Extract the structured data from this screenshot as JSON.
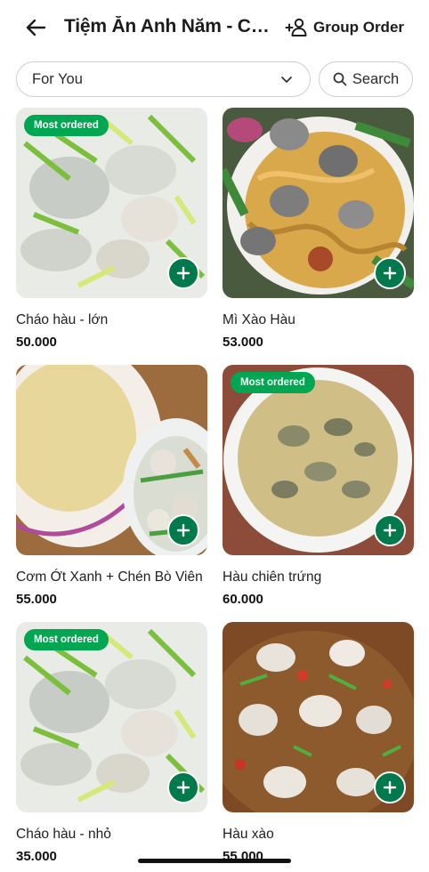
{
  "header": {
    "title": "Tiệm Ăn Anh Năm - Chợ Lớn",
    "group_order_label": "Group Order"
  },
  "filter": {
    "category_value": "For You",
    "search_label": "Search"
  },
  "badges": {
    "most_ordered": "Most ordered"
  },
  "colors": {
    "accent": "#00a651",
    "add_button": "#00794c"
  },
  "icons": {
    "back": "arrow-left-icon",
    "group": "group-add-icon",
    "chevron": "chevron-down-icon",
    "search": "search-icon",
    "add": "plus-icon"
  },
  "menu": {
    "items": [
      {
        "name": "Cháo hàu - lớn",
        "price": "50.000",
        "most_ordered": true
      },
      {
        "name": "Mì Xào Hàu",
        "price": "53.000",
        "most_ordered": false
      },
      {
        "name": "Cơm Ớt Xanh + Chén Bò Viên",
        "price": "55.000",
        "most_ordered": false
      },
      {
        "name": "Hàu chiên trứng",
        "price": "60.000",
        "most_ordered": true
      },
      {
        "name": "Cháo hàu - nhỏ",
        "price": "35.000",
        "most_ordered": true
      },
      {
        "name": "Hàu xào",
        "price": "55.000",
        "most_ordered": false
      }
    ]
  }
}
